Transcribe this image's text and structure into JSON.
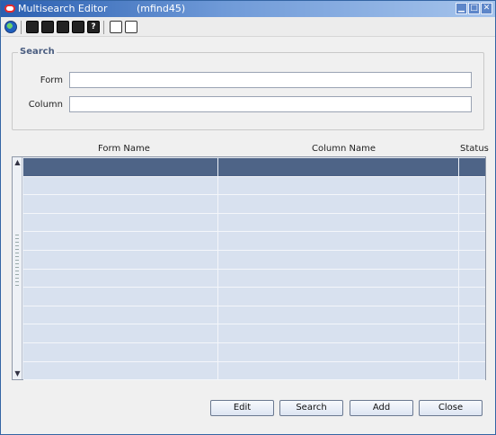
{
  "window": {
    "title": "Multisearch Editor",
    "form_id": "(mfind45)",
    "minimize": "▁",
    "maximize": "□",
    "close": "✕"
  },
  "toolbar": {
    "icons": [
      "globe-icon",
      "cycle-icon",
      "lookup-icon",
      "print-icon",
      "list-icon",
      "help-icon",
      "blank-page-icon",
      "new-page-icon"
    ],
    "help_glyph": "?"
  },
  "search": {
    "group_title": "Search",
    "form_label": "Form",
    "form_value": "",
    "column_label": "Column",
    "column_value": ""
  },
  "table": {
    "headers": [
      "Form Name",
      "Column Name",
      "Status"
    ],
    "row_count": 12,
    "selected_row": 0
  },
  "buttons": {
    "edit": "Edit",
    "search": "Search",
    "add": "Add",
    "close": "Close"
  },
  "colors": {
    "titlebar": "#2a5fb0",
    "selected_row": "#4e6487",
    "grid_cell": "#d8e1ef"
  }
}
